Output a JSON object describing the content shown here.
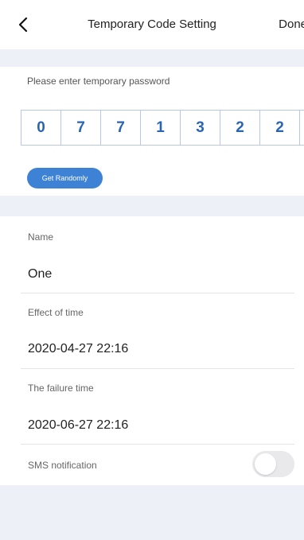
{
  "header": {
    "title": "Temporary Code Setting",
    "done_label": "Done",
    "back_icon": "chevron-left-icon"
  },
  "password": {
    "prompt": "Please enter temporary password",
    "digits": [
      "0",
      "7",
      "7",
      "1",
      "3",
      "2",
      "2"
    ],
    "random_label": "Get Randomly"
  },
  "form": {
    "name_label": "Name",
    "name_value": "One",
    "effect_label": "Effect of time",
    "effect_value": "2020-04-27 22:16",
    "failure_label": "The failure time",
    "failure_value": "2020-06-27 22:16",
    "sms_label": "SMS notification",
    "sms_enabled": false
  },
  "colors": {
    "accent": "#3e82d6",
    "digit_text": "#2a64b5",
    "background": "#eef0f7"
  }
}
